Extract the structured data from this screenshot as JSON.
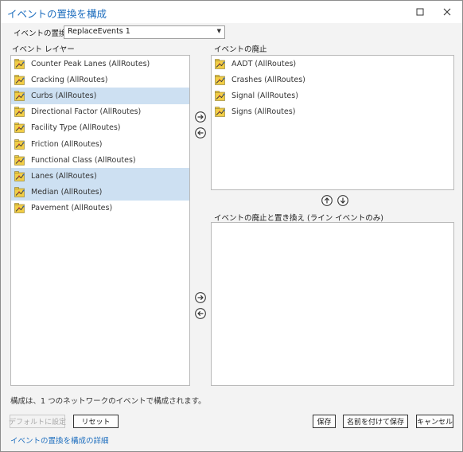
{
  "window": {
    "title": "イベントの置換を構成",
    "minimize_icon": "minimize-icon",
    "close_icon": "close-icon"
  },
  "replace": {
    "label": "イベントの置換",
    "selected": "ReplaceEvents 1"
  },
  "event_layers": {
    "label": "イベント レイヤー",
    "items": [
      {
        "label": "Counter Peak Lanes (AllRoutes)",
        "selected": false
      },
      {
        "label": "Cracking (AllRoutes)",
        "selected": false
      },
      {
        "label": "Curbs (AllRoutes)",
        "selected": true
      },
      {
        "label": "Directional Factor (AllRoutes)",
        "selected": false
      },
      {
        "label": "Facility Type (AllRoutes)",
        "selected": false
      },
      {
        "label": "Friction (AllRoutes)",
        "selected": false
      },
      {
        "label": "Functional Class (AllRoutes)",
        "selected": false
      },
      {
        "label": "Lanes (AllRoutes)",
        "selected": true
      },
      {
        "label": "Median (AllRoutes)",
        "selected": true
      },
      {
        "label": "Pavement (AllRoutes)",
        "selected": false
      }
    ]
  },
  "retire": {
    "label": "イベントの廃止",
    "items": [
      {
        "label": "AADT (AllRoutes)"
      },
      {
        "label": "Crashes (AllRoutes)"
      },
      {
        "label": "Signal (AllRoutes)"
      },
      {
        "label": "Signs (AllRoutes)"
      }
    ]
  },
  "retire_replace": {
    "label": "イベントの廃止と置き換え (ライン イベントのみ)",
    "items": []
  },
  "status_text": "構成は、1 つのネットワークのイベントで構成されます。",
  "buttons": {
    "default": "デフォルトに設定",
    "reset": "リセット",
    "save": "保存",
    "save_as": "名前を付けて保存",
    "cancel": "キャンセル"
  },
  "help_link": "イベントの置換を構成の詳細",
  "icons": {
    "layer": "event-layer-icon",
    "add": "arrow-right-icon",
    "remove": "arrow-left-icon",
    "up": "arrow-up-icon",
    "down": "arrow-down-icon",
    "dropdown": "chevron-down-icon"
  },
  "colors": {
    "accent": "#1f6fbf",
    "selection": "#cde0f2",
    "layer_icon": "#f2cd45"
  }
}
